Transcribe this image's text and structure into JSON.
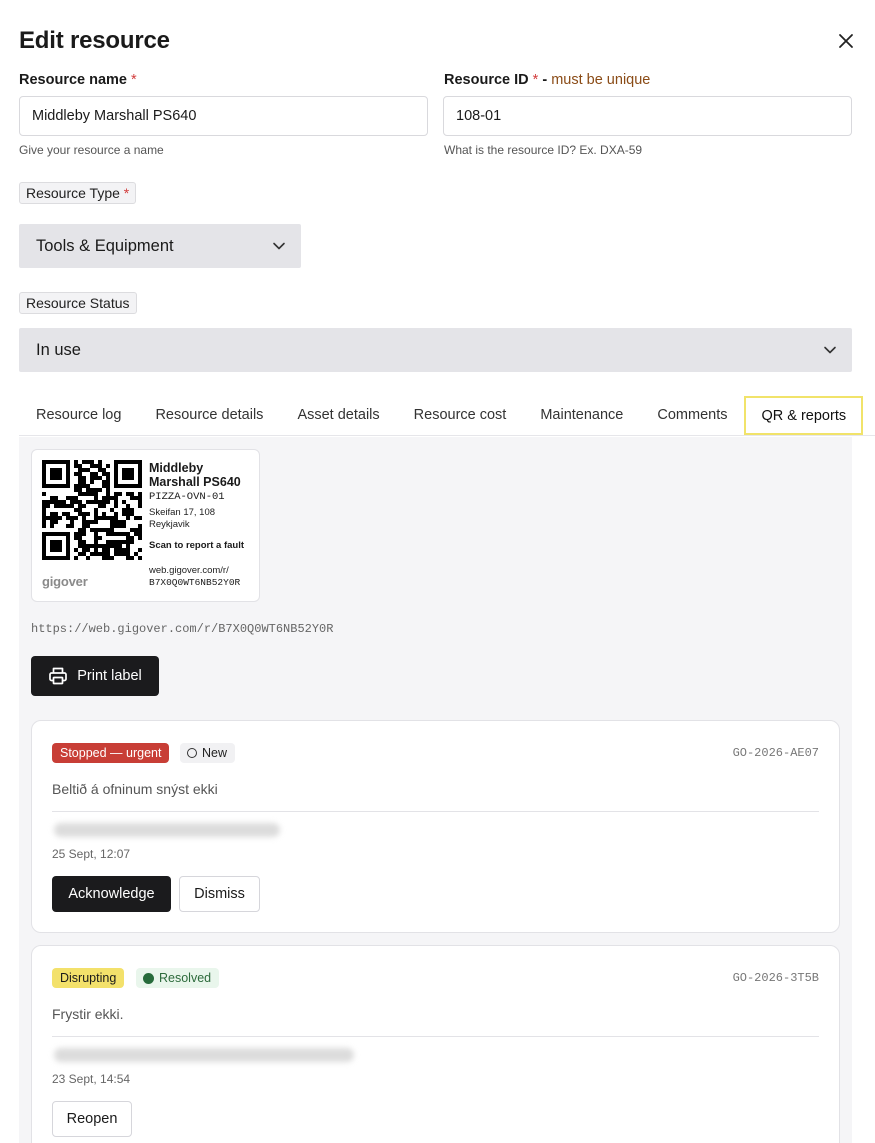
{
  "header": {
    "title": "Edit resource"
  },
  "form": {
    "resource_name": {
      "label": "Resource name",
      "required_mark": "*",
      "value": "Middleby Marshall PS640",
      "hint": "Give your resource a name"
    },
    "resource_id": {
      "label": "Resource ID",
      "required_mark": "*",
      "separator": " - ",
      "note": "must be unique",
      "value": "108-01",
      "hint": "What is the resource ID? Ex. DXA-59"
    },
    "resource_type": {
      "label": "Resource Type",
      "required_mark": "*",
      "selected": "Tools & Equipment"
    },
    "resource_status": {
      "label": "Resource Status",
      "selected": "In use"
    }
  },
  "tabs": [
    {
      "label": "Resource log"
    },
    {
      "label": "Resource details"
    },
    {
      "label": "Asset details"
    },
    {
      "label": "Resource cost"
    },
    {
      "label": "Maintenance"
    },
    {
      "label": "Comments"
    },
    {
      "label": "QR & reports",
      "active": true
    }
  ],
  "qr_label": {
    "name": "Middleby Marshall PS640",
    "code": "PIZZA-OVN-01",
    "address": "Skeifan 17, 108 Reykjavik",
    "scan_text": "Scan to report a fault",
    "web": "web.gigover.com/r/",
    "web_code": "B7X0Q0WT6NB52Y0R",
    "logo": "gigover"
  },
  "url": "https://web.gigover.com/r/B7X0Q0WT6NB52Y0R",
  "print_button": "Print label",
  "reports": [
    {
      "severity": "Stopped — urgent",
      "status": "New",
      "id": "GO-2026-AE07",
      "description": "Beltið á ofninum snýst ekki",
      "time": "25 Sept, 12:07",
      "actions": [
        "Acknowledge",
        "Dismiss"
      ]
    },
    {
      "severity": "Disrupting",
      "status": "Resolved",
      "id": "GO-2026-3T5B",
      "description": "Frystir ekki.",
      "time": "23 Sept, 14:54",
      "actions": [
        "Reopen"
      ]
    }
  ],
  "colors": {
    "urgent": "#c83e36",
    "disrupting": "#f3e16b",
    "resolved": "#276b3b",
    "active_tab_border": "#f1e36a",
    "dark_button": "#1b1b1d"
  },
  "icons": {
    "close": "close-icon",
    "chevron": "chevron-down-icon",
    "printer": "printer-icon",
    "qr": "qr-code-icon"
  }
}
